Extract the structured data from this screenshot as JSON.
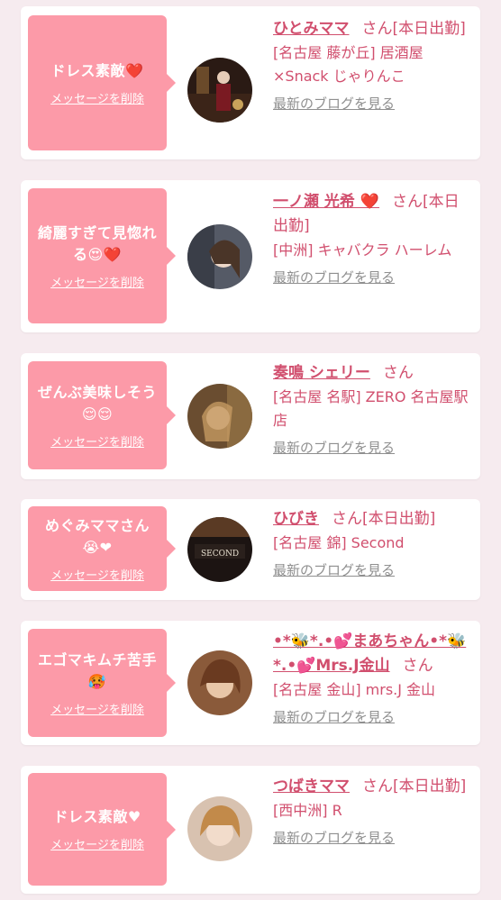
{
  "delete_label": "メッセージを削除",
  "blog_label": "最新のブログを見る",
  "san": "さん",
  "items": [
    {
      "message": "ドレス素敵❤️",
      "name": "ひとみママ",
      "status": "[本日出勤]",
      "shop": "[名古屋 藤が丘] 居酒屋×Snack じゃりんこ"
    },
    {
      "message": "綺麗すぎて見惚れる😍❤️",
      "name": "一ノ瀬 光希 ❤️",
      "status": "[本日出勤]",
      "shop": "[中洲] キャバクラ ハーレム"
    },
    {
      "message": "ぜんぶ美味しそう😌😌",
      "name": "奏鳴 シェリー",
      "status": "",
      "shop": "[名古屋 名駅] ZERO 名古屋駅店"
    },
    {
      "message": "めぐみママさん😭❤",
      "name": "ひびき",
      "status": "[本日出勤]",
      "shop": "[名古屋 錦] Second"
    },
    {
      "message": "エゴマキムチ苦手🥵",
      "name": "•*🐝*.•💕まあちゃん•*🐝*.•💕Mrs.J金山",
      "status": "",
      "shop": "[名古屋 金山] mrs.J 金山"
    },
    {
      "message": "ドレス素敵♥",
      "name": "つばきママ",
      "status": "[本日出勤]",
      "shop": "[西中洲] R"
    }
  ]
}
